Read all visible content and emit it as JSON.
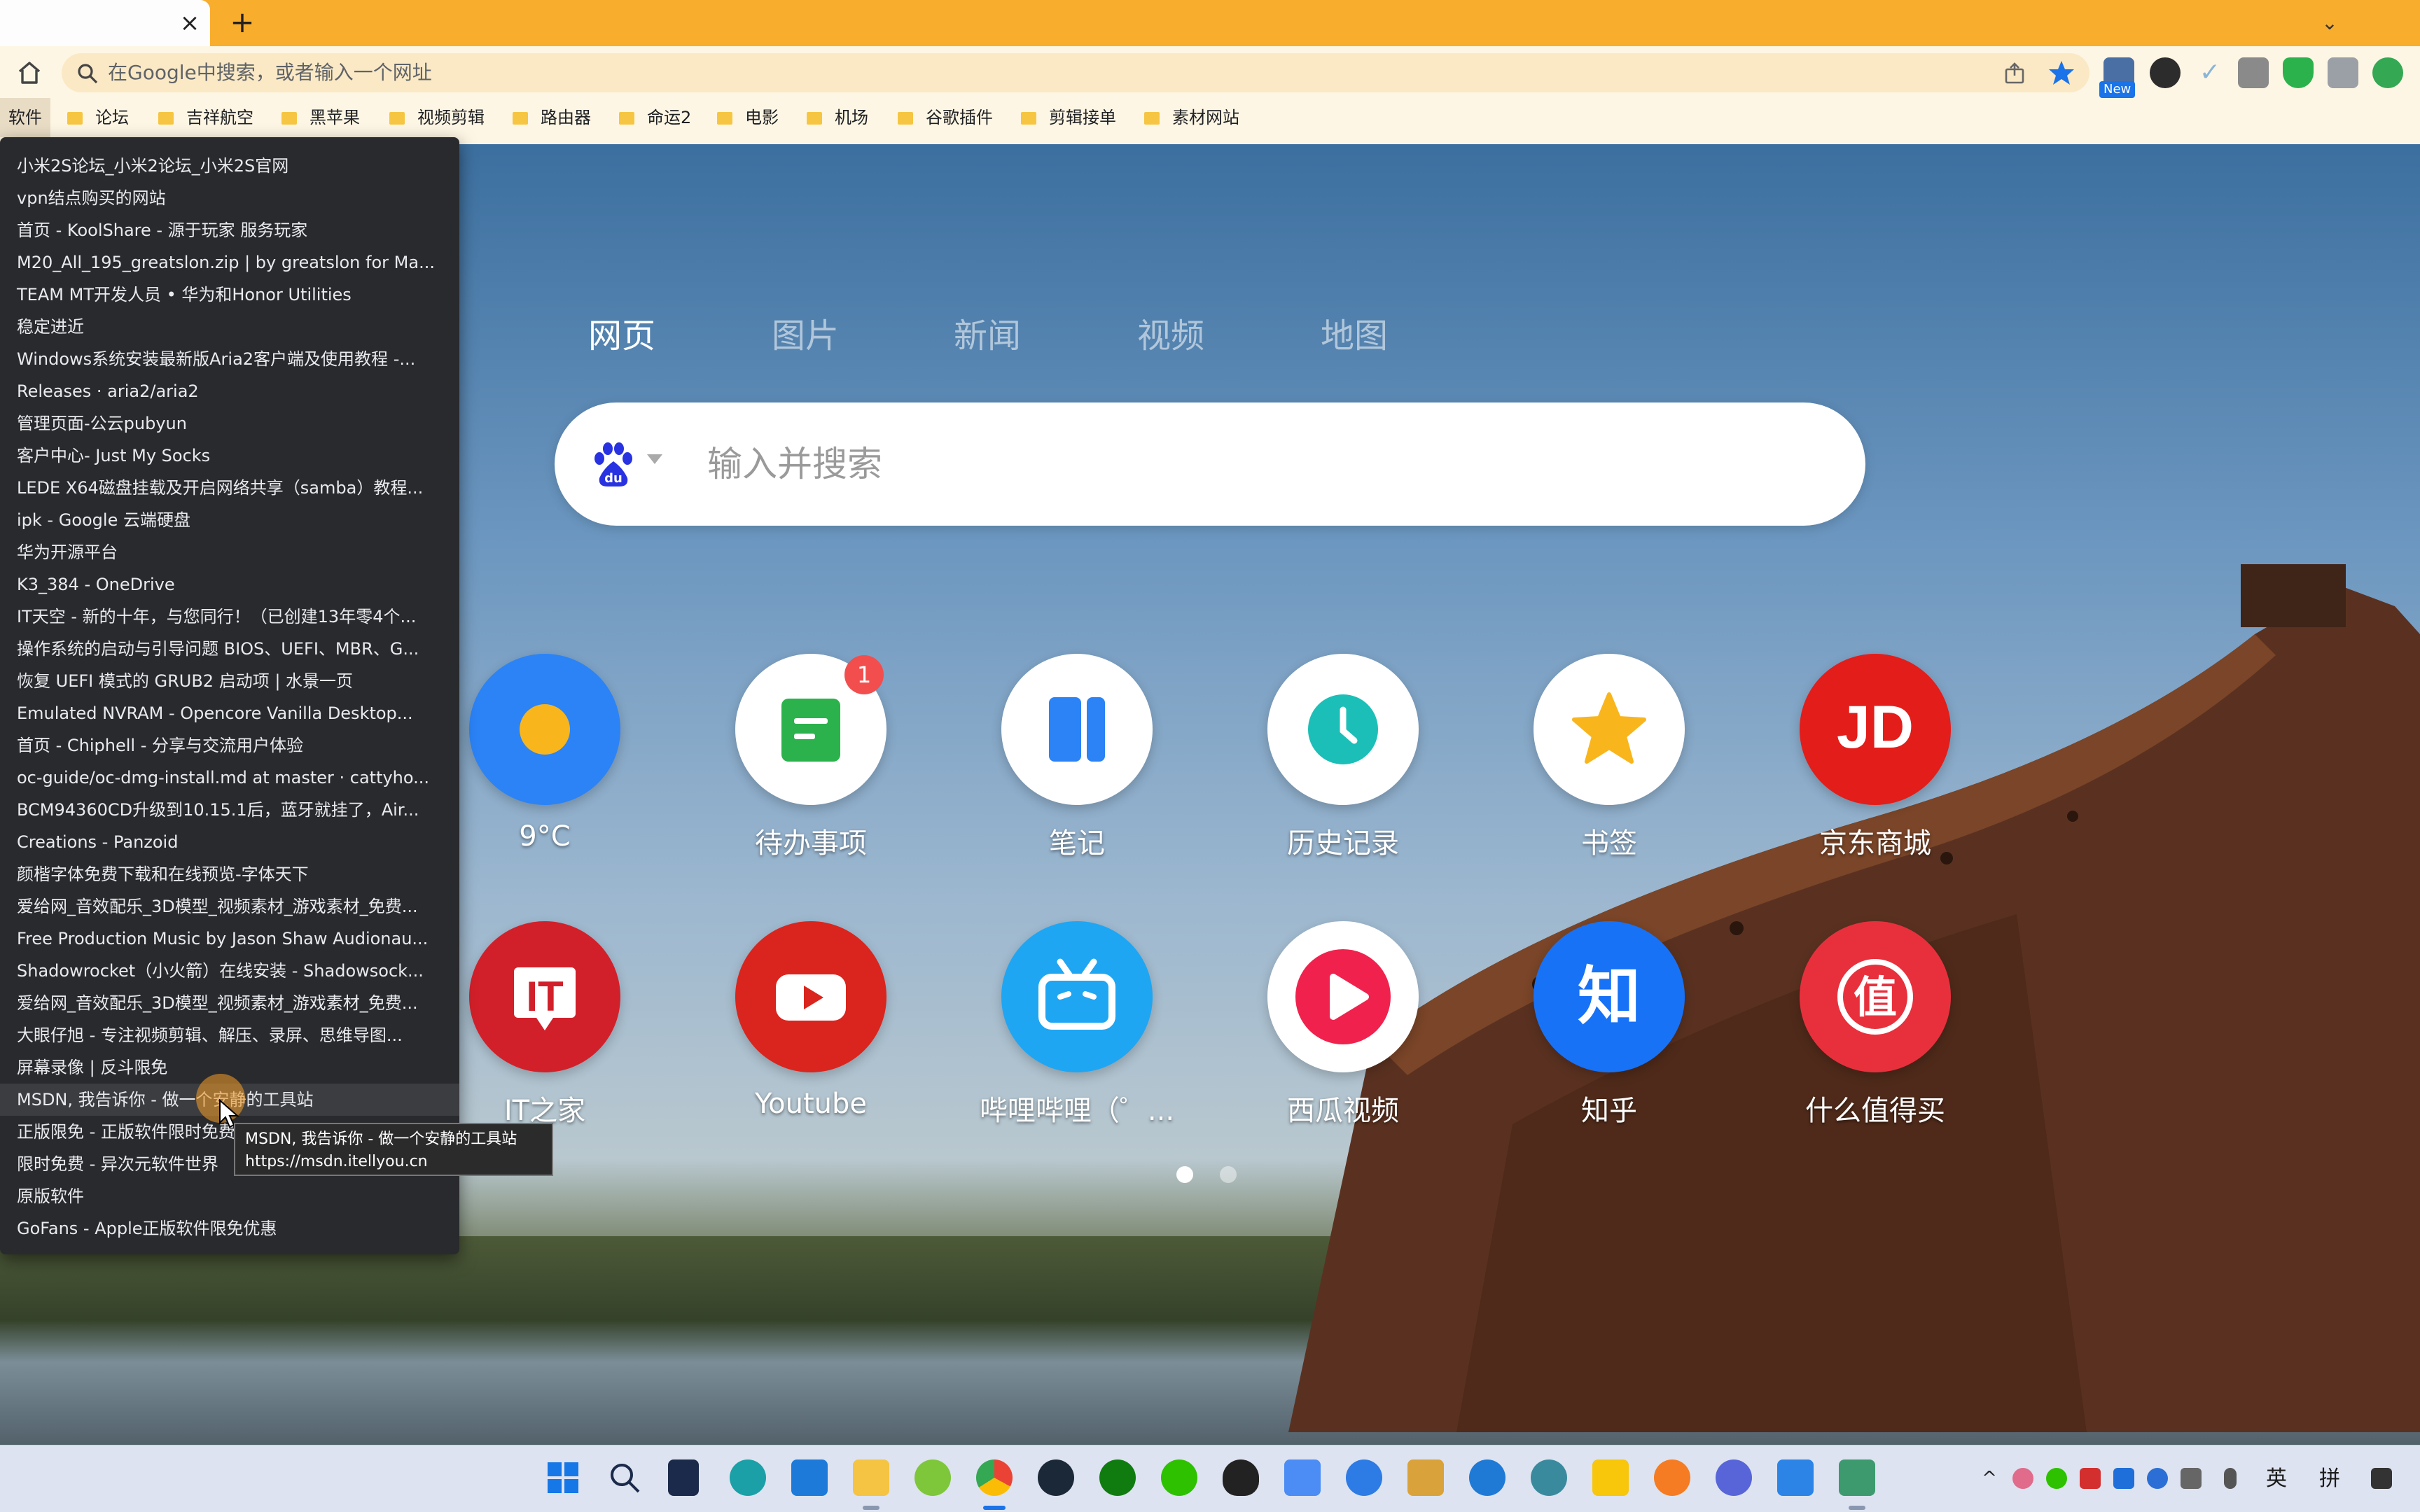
{
  "browser": {
    "tab_close_glyph": "×",
    "new_tab_glyph": "+",
    "tab_dropdown_glyph": "⌄",
    "omnibox_placeholder": "在Google中搜索，或者输入一个网址",
    "ext_badge": "New"
  },
  "bookmarks_bar": {
    "first": "软件",
    "items": [
      "论坛",
      "吉祥航空",
      "黑苹果",
      "视频剪辑",
      "路由器",
      "命运2",
      "电影",
      "机场",
      "谷歌插件",
      "剪辑接单",
      "素材网站"
    ]
  },
  "newtab": {
    "search_tabs": [
      "网页",
      "图片",
      "新闻",
      "视频",
      "地图"
    ],
    "active_tab": "网页",
    "search_placeholder": "输入并搜索",
    "tiles_row1": [
      {
        "label": "9°C",
        "icon": "weather-sun-icon"
      },
      {
        "label": "待办事项",
        "icon": "todo-icon",
        "badge": "1"
      },
      {
        "label": "笔记",
        "icon": "notes-icon"
      },
      {
        "label": "历史记录",
        "icon": "history-clock-icon"
      },
      {
        "label": "书签",
        "icon": "bookmark-star-icon"
      },
      {
        "label": "京东商城",
        "icon": "jd-logo-icon",
        "logo_text": "JD"
      }
    ],
    "tiles_row2": [
      {
        "label": "IT之家",
        "icon": "ithome-logo-icon",
        "logo_text": "IT"
      },
      {
        "label": "Youtube",
        "icon": "youtube-logo-icon"
      },
      {
        "label": "哔哩哔哩（゜...",
        "icon": "bilibili-logo-icon"
      },
      {
        "label": "西瓜视频",
        "icon": "xigua-logo-icon"
      },
      {
        "label": "知乎",
        "icon": "zhihu-logo-icon",
        "logo_text": "知"
      },
      {
        "label": "什么值得买",
        "icon": "smzdm-logo-icon",
        "logo_text": "值"
      }
    ]
  },
  "bookmark_menu": {
    "items": [
      "小米2S论坛_小米2论坛_小米2S官网",
      "vpn结点购买的网站",
      "首页 - KoolShare - 源于玩家 服务玩家",
      "M20_All_195_greatslon.zip | by greatslon for Ma...",
      "TEAM MT开发人员 • 华为和Honor Utilities",
      "稳定进近",
      "Windows系统安装最新版Aria2客户端及使用教程 -...",
      "Releases · aria2/aria2",
      "管理页面-公云pubyun",
      "客户中心- Just My Socks",
      "LEDE X64磁盘挂载及开启网络共享（samba）教程...",
      "ipk - Google 云端硬盘",
      "华为开源平台",
      "K3_384 - OneDrive",
      "IT天空 - 新的十年，与您同行！（已创建13年零4个...",
      "操作系统的启动与引导问题 BIOS、UEFI、MBR、G...",
      "恢复 UEFI 模式的 GRUB2 启动项 | 水景一页",
      "Emulated NVRAM - Opencore Vanilla Desktop...",
      "首页 - Chiphell - 分享与交流用户体验",
      "oc-guide/oc-dmg-install.md at master · cattyho...",
      "BCM94360CD升级到10.15.1后，蓝牙就挂了，Air...",
      "Creations - Panzoid",
      "颜楷字体免费下载和在线预览-字体天下",
      "爱给网_音效配乐_3D模型_视频素材_游戏素材_免费...",
      "Free Production Music by Jason Shaw Audionau...",
      "Shadowrocket（小火箭）在线安装 - Shadowsock...",
      "爱给网_音效配乐_3D模型_视频素材_游戏素材_免费...",
      "大眼仔旭 - 专注视频剪辑、解压、录屏、思维导图...",
      "屏幕录像 | 反斗限免",
      "MSDN, 我告诉你 - 做一个安静的工具站",
      "正版限免 - 正版软件限时免费",
      "限时免费 - 异次元软件世界",
      "原版软件",
      "GoFans - Apple正版软件限免优惠"
    ],
    "hover_index": 29
  },
  "tooltip": {
    "title": "MSDN, 我告诉你 - 做一个安静的工具站",
    "url": "https://msdn.itellyou.cn"
  },
  "taskbar": {
    "ime_lang": "英",
    "ime_mode": "拼"
  },
  "colors": {
    "titlebar": "#f9ad2c",
    "toolbar": "#fef6e4",
    "menu_bg": "#292a2d",
    "accent_blue": "#1a73e8"
  }
}
